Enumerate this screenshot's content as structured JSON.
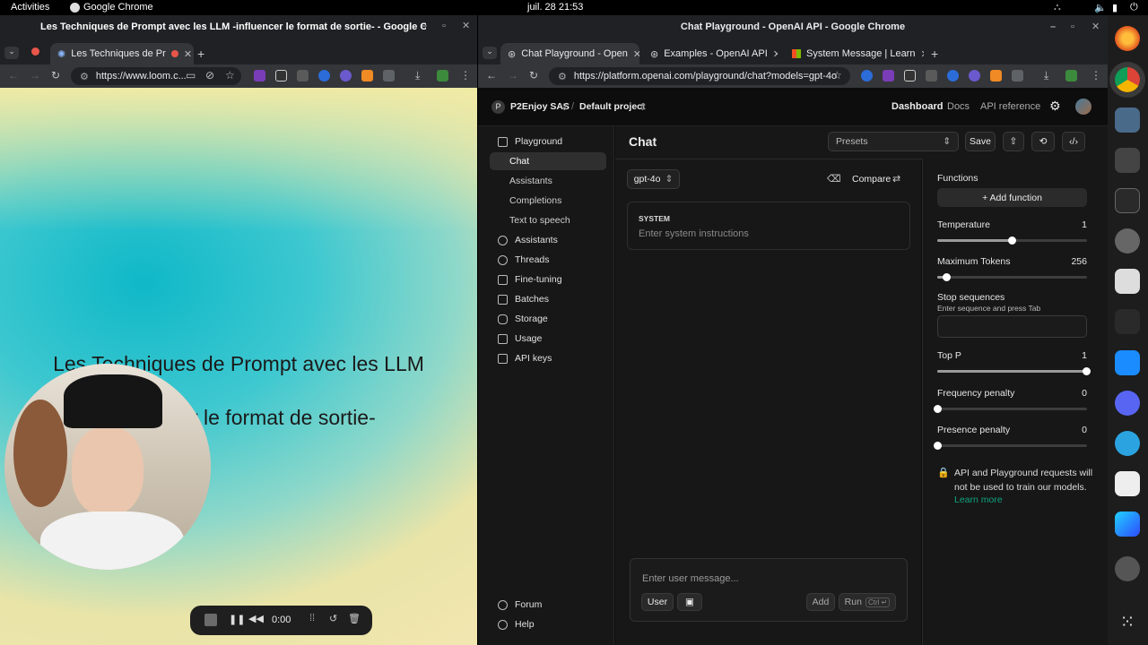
{
  "topbar": {
    "activities": "Activities",
    "app": "Google Chrome",
    "clock": "juil. 28  21:53"
  },
  "left_window": {
    "title": "Les Techniques de Prompt avec les LLM -influencer le format de sortie- - Google Chrome",
    "tab_label": "Les Techniques de Pr",
    "url": "https://www.loom.c...",
    "video_title_line1": "Les Techniques de Prompt avec les LLM",
    "video_title_line2": "-influencer le format de sortie-",
    "rec_time": "0:00"
  },
  "right_window": {
    "title": "Chat Playground - OpenAI API - Google Chrome",
    "tabs": [
      {
        "label": "Chat Playground - Open"
      },
      {
        "label": "Examples - OpenAI API"
      },
      {
        "label": "System Message | Learn"
      }
    ],
    "url": "https://platform.openai.com/playground/chat?models=gpt-4o"
  },
  "playground": {
    "org_initial": "P",
    "org": "P2Enjoy SAS",
    "project": "Default project",
    "header_links": [
      "Dashboard",
      "Docs",
      "API reference"
    ],
    "nav": [
      {
        "label": "Playground",
        "sub": false
      },
      {
        "label": "Chat",
        "sub": true
      },
      {
        "label": "Assistants",
        "sub": true
      },
      {
        "label": "Completions",
        "sub": true
      },
      {
        "label": "Text to speech",
        "sub": true
      },
      {
        "label": "Assistants",
        "sub": false
      },
      {
        "label": "Threads",
        "sub": false
      },
      {
        "label": "Fine-tuning",
        "sub": false
      },
      {
        "label": "Batches",
        "sub": false
      },
      {
        "label": "Storage",
        "sub": false
      },
      {
        "label": "Usage",
        "sub": false
      },
      {
        "label": "API keys",
        "sub": false
      }
    ],
    "footer_nav": [
      "Forum",
      "Help"
    ],
    "page_title": "Chat",
    "presets_placeholder": "Presets",
    "save_label": "Save",
    "model": "gpt-4o",
    "compare_label": "Compare",
    "system_label": "SYSTEM",
    "system_placeholder": "Enter system instructions",
    "user_placeholder": "Enter user message...",
    "role_label": "User",
    "add_label": "Add",
    "run_label": "Run",
    "run_shortcut": "Ctrl ↵",
    "settings": {
      "functions_label": "Functions",
      "add_function": "+ Add function",
      "temperature_label": "Temperature",
      "temperature": "1",
      "temperature_frac": 0.5,
      "max_tokens_label": "Maximum Tokens",
      "max_tokens": "256",
      "max_tokens_frac": 0.06,
      "stop_label": "Stop sequences",
      "stop_hint": "Enter sequence and press Tab",
      "top_p_label": "Top P",
      "top_p": "1",
      "top_p_frac": 1.0,
      "freq_label": "Frequency penalty",
      "freq": "0",
      "freq_frac": 0.0,
      "pres_label": "Presence penalty",
      "pres": "0",
      "pres_frac": 0.0,
      "notice": "API and Playground requests will not be used to train our models.",
      "learn_more": "Learn more"
    }
  },
  "colors": {
    "accent_green": "#10a37f",
    "chrome_dark": "#202124"
  }
}
